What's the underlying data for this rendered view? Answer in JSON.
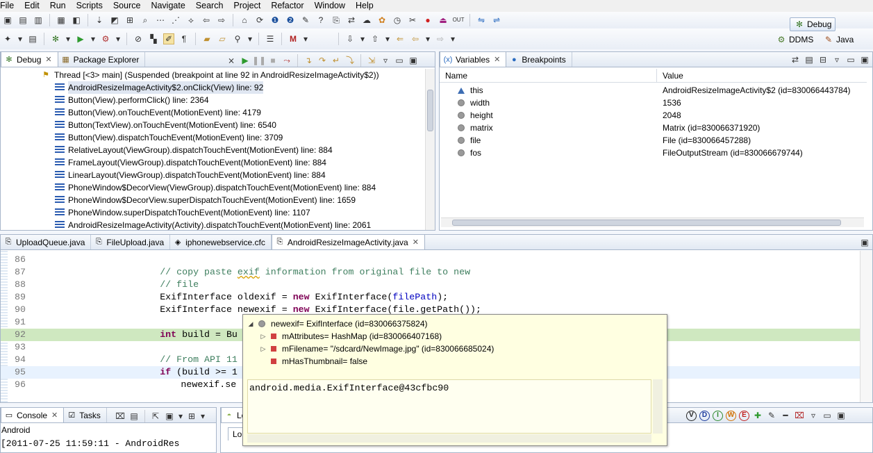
{
  "menu": [
    "File",
    "Edit",
    "Run",
    "Scripts",
    "Source",
    "Navigate",
    "Search",
    "Project",
    "Refactor",
    "Window",
    "Help"
  ],
  "perspectives": {
    "debug": "Debug",
    "ddms": "DDMS",
    "java": "Java"
  },
  "debug_view": {
    "tabs": [
      {
        "label": "Debug",
        "icon": "debug-icon"
      },
      {
        "label": "Package Explorer",
        "icon": "package-explorer-icon"
      }
    ],
    "thread": "Thread [<3> main] (Suspended (breakpoint at line 92 in AndroidResizeImageActivity$2))",
    "frames": [
      "AndroidResizeImageActivity$2.onClick(View) line: 92",
      "Button(View).performClick() line: 2364",
      "Button(View).onTouchEvent(MotionEvent) line: 4179",
      "Button(TextView).onTouchEvent(MotionEvent) line: 6540",
      "Button(View).dispatchTouchEvent(MotionEvent) line: 3709",
      "RelativeLayout(ViewGroup).dispatchTouchEvent(MotionEvent) line: 884",
      "FrameLayout(ViewGroup).dispatchTouchEvent(MotionEvent) line: 884",
      "LinearLayout(ViewGroup).dispatchTouchEvent(MotionEvent) line: 884",
      "PhoneWindow$DecorView(ViewGroup).dispatchTouchEvent(MotionEvent) line: 884",
      "PhoneWindow$DecorView.superDispatchTouchEvent(MotionEvent) line: 1659",
      "PhoneWindow.superDispatchTouchEvent(MotionEvent) line: 1107",
      "AndroidResizeImageActivity(Activity).dispatchTouchEvent(MotionEvent) line: 2061"
    ]
  },
  "variables_view": {
    "tabs": [
      {
        "label": "Variables",
        "icon": "variables-icon"
      },
      {
        "label": "Breakpoints",
        "icon": "breakpoints-icon"
      }
    ],
    "columns": [
      "Name",
      "Value"
    ],
    "rows": [
      {
        "name": "this",
        "value": "AndroidResizeImageActivity$2  (id=830066443784)",
        "icon": "this-icon"
      },
      {
        "name": "width",
        "value": "1536",
        "icon": "local-variable-icon"
      },
      {
        "name": "height",
        "value": "2048",
        "icon": "local-variable-icon"
      },
      {
        "name": "matrix",
        "value": "Matrix  (id=830066371920)",
        "icon": "local-variable-icon"
      },
      {
        "name": "file",
        "value": "File  (id=830066457288)",
        "icon": "local-variable-icon"
      },
      {
        "name": "fos",
        "value": "FileOutputStream  (id=830066679744)",
        "icon": "local-variable-icon"
      }
    ]
  },
  "editor": {
    "tabs": [
      {
        "label": "UploadQueue.java",
        "icon": "java-file-icon"
      },
      {
        "label": "FileUpload.java",
        "icon": "java-file-icon"
      },
      {
        "label": "iphonewebservice.cfc",
        "icon": "cfc-file-icon"
      },
      {
        "label": "AndroidResizeImageActivity.java",
        "icon": "java-file-icon"
      }
    ],
    "active_tab": "AndroidResizeImageActivity.java",
    "lines": [
      {
        "n": "86",
        "code": ""
      },
      {
        "n": "87",
        "code": "// copy paste exif information from original file to new"
      },
      {
        "n": "88",
        "code": "// file"
      },
      {
        "n": "89",
        "code": "ExifInterface oldexif = new ExifInterface(filePath);"
      },
      {
        "n": "90",
        "code": "ExifInterface newexif = new ExifInterface(file.getPath());"
      },
      {
        "n": "91",
        "code": ""
      },
      {
        "n": "92",
        "code": "int build = Bu"
      },
      {
        "n": "93",
        "code": ""
      },
      {
        "n": "94",
        "code": "// From API 11"
      },
      {
        "n": "95",
        "code": "if (build >= 1"
      },
      {
        "n": "96",
        "code": "newexif.se"
      }
    ]
  },
  "hover": {
    "root": "newexif= ExifInterface  (id=830066375824)",
    "children": [
      "mAttributes= HashMap  (id=830066407168)",
      "mFilename= \"/sdcard/NewImage.jpg\" (id=830066685024)",
      "mHasThumbnail= false"
    ],
    "detail": "android.media.ExifInterface@43cfbc90"
  },
  "console": {
    "tabs": [
      {
        "label": "Console",
        "icon": "console-icon"
      },
      {
        "label": "Tasks",
        "icon": "tasks-icon"
      }
    ],
    "source": "Android",
    "line": "[2011-07-25 11:59:11 - AndroidRes"
  },
  "logcat": {
    "tab": "Lo",
    "subtab": "Lo",
    "level_buttons": [
      "V",
      "D",
      "I",
      "W",
      "E"
    ]
  },
  "colors": {
    "accent": "#3d6db3",
    "breakpoint_line": "#cfe8c0",
    "hover_bg": "#ffffe1",
    "keyword": "#7f0055",
    "comment": "#3f7f5f"
  }
}
